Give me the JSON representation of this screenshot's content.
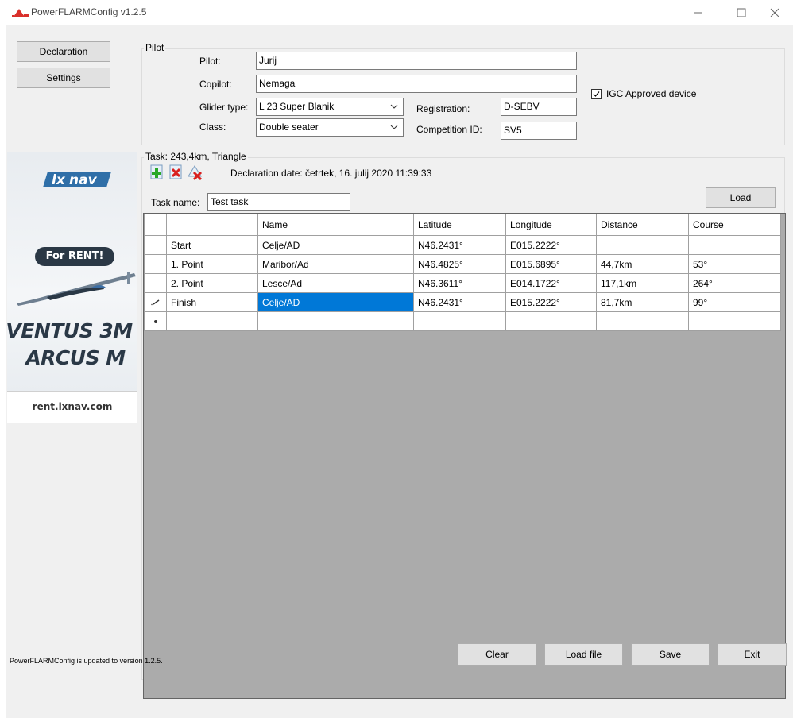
{
  "window": {
    "title": "PowerFLARMConfig v1.2.5"
  },
  "nav": {
    "declaration": "Declaration",
    "settings": "Settings"
  },
  "ad": {
    "rent": "For RENT!",
    "line1": "VENTUS 3M",
    "line2": "ARCUS M",
    "url": "rent.lxnav.com"
  },
  "pilot_group": {
    "legend": "Pilot",
    "pilot_label": "Pilot:",
    "pilot_value": "Jurij",
    "copilot_label": "Copilot:",
    "copilot_value": "Nemaga",
    "glider_label": "Glider type:",
    "glider_value": "L 23 Super Blanik",
    "class_label": "Class:",
    "class_value": "Double seater",
    "registration_label": "Registration:",
    "registration_value": "D-SEBV",
    "competition_label": "Competition ID:",
    "competition_value": "SV5",
    "igc_label": "IGC Approved device",
    "igc_checked": true
  },
  "task_group": {
    "legend": "Task: 243,4km, Triangle",
    "declaration_date": "Declaration date: četrtek, 16. julij 2020 11:39:33",
    "task_name_label": "Task name:",
    "task_name_value": "Test task",
    "load_label": "Load"
  },
  "grid": {
    "columns": [
      "",
      "Name",
      "Latitude",
      "Longitude",
      "Distance",
      "Course"
    ],
    "rows": [
      {
        "marker": "",
        "cells": [
          "Start",
          "Celje/AD",
          "N46.2431°",
          "E015.2222°",
          "",
          ""
        ]
      },
      {
        "marker": "",
        "cells": [
          "1. Point",
          "Maribor/Ad",
          "N46.4825°",
          "E015.6895°",
          "44,7km",
          "53°"
        ]
      },
      {
        "marker": "",
        "cells": [
          "2. Point",
          "Lesce/Ad",
          "N46.3611°",
          "E014.1722°",
          "117,1km",
          "264°"
        ]
      },
      {
        "marker": "pencil",
        "cells": [
          "Finish",
          "Celje/AD",
          "N46.2431°",
          "E015.2222°",
          "81,7km",
          "99°"
        ]
      },
      {
        "marker": "new",
        "cells": [
          "",
          "",
          "",
          "",
          "",
          ""
        ]
      }
    ]
  },
  "buttons": {
    "clear": "Clear",
    "load_file": "Load file",
    "save": "Save",
    "exit": "Exit"
  },
  "status_text": "PowerFLARMConfig is updated to version 1.2.5."
}
